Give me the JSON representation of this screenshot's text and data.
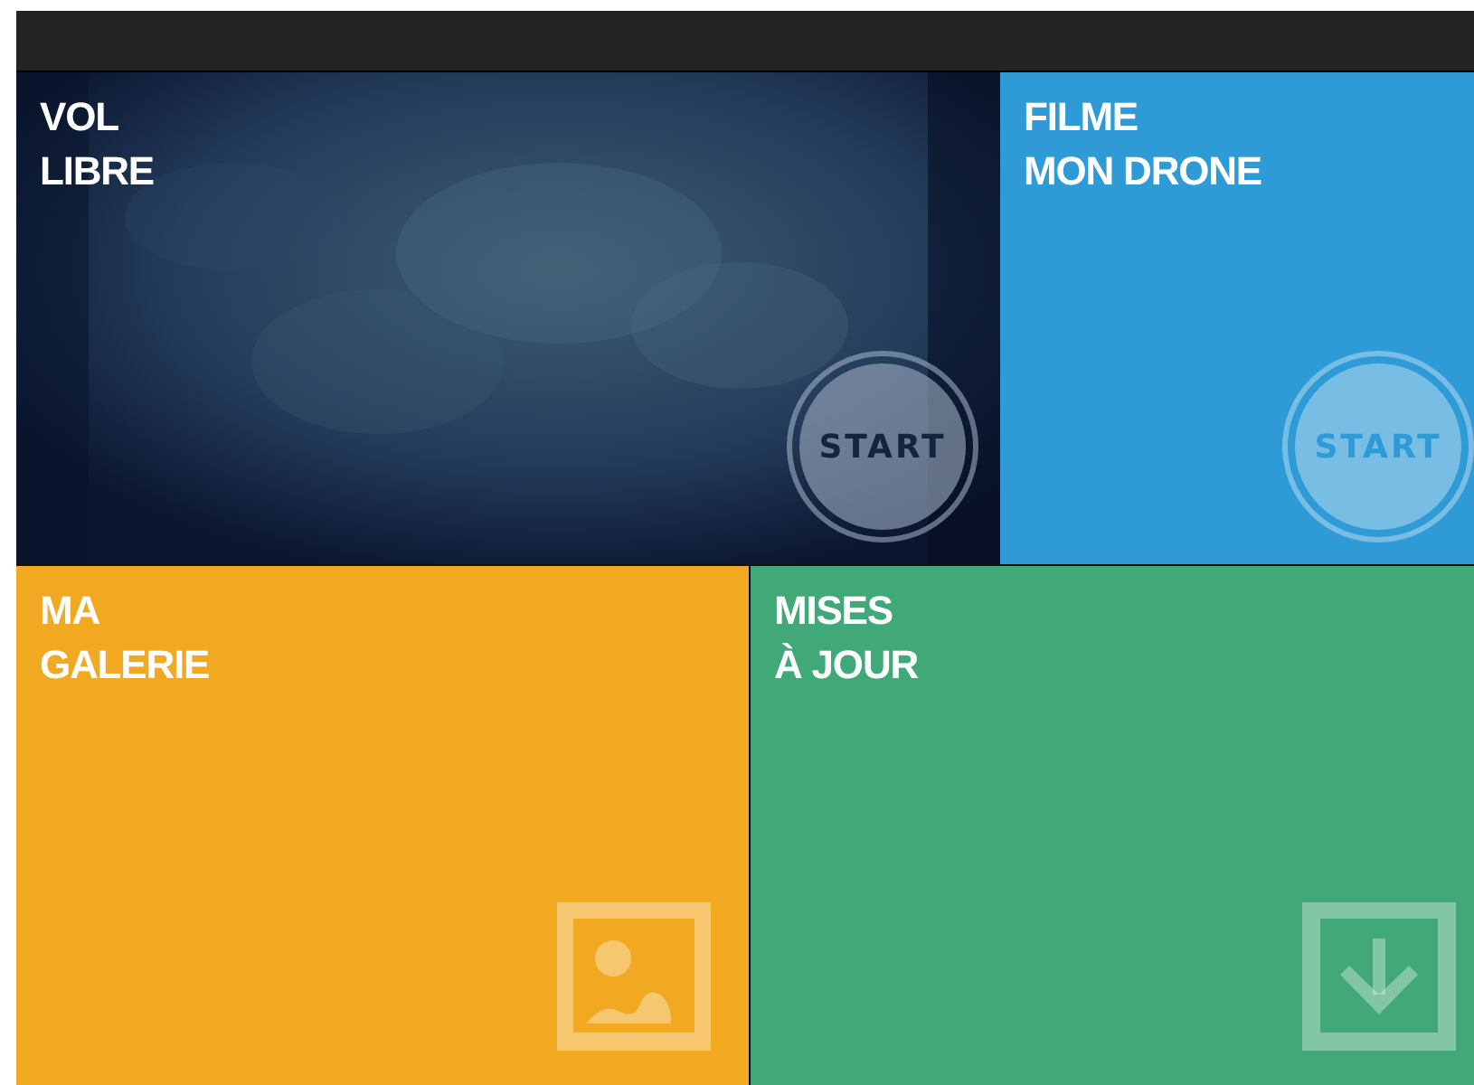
{
  "tiles": [
    {
      "kind": "picture",
      "title": [
        "VOL",
        "LIBRE"
      ],
      "action": {
        "kind": "start",
        "label": "START"
      }
    },
    {
      "kind": "color",
      "color": "#2e9ad6",
      "title": [
        "FILME",
        "MON DRONE"
      ],
      "action": {
        "kind": "start",
        "label": "START"
      }
    },
    {
      "kind": "color",
      "color": "#f2a922",
      "title": [
        "MA",
        "GALERIE"
      ],
      "action": {
        "kind": "gallery"
      }
    },
    {
      "kind": "color",
      "color": "#41a877",
      "title": [
        "MISES",
        "À JOUR"
      ],
      "action": {
        "kind": "download"
      }
    }
  ]
}
